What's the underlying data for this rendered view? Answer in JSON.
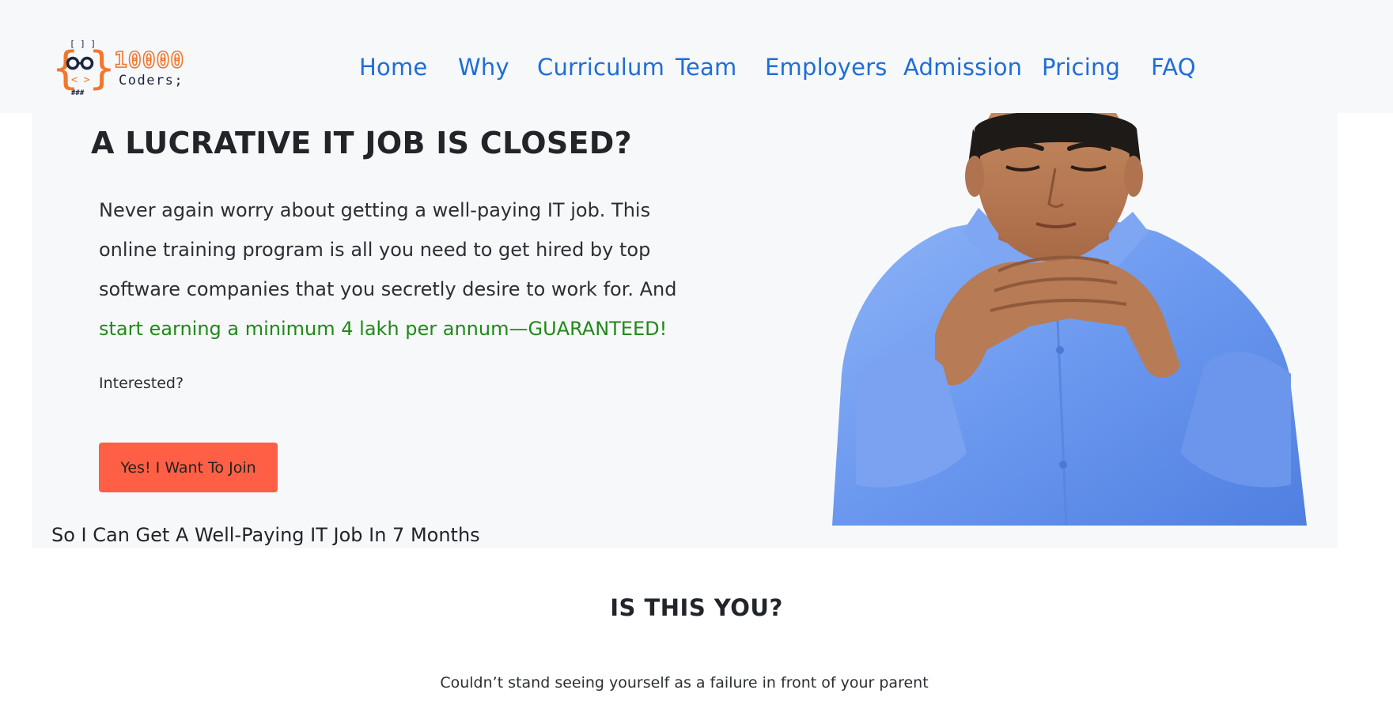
{
  "brand": {
    "logo_number": "10000",
    "logo_word": "Coders;",
    "logo_glyph_top": "[ ] ]",
    "logo_glyph_bottom": "###",
    "colors": {
      "orange": "#f0782d",
      "navy": "#1b2440"
    }
  },
  "nav": {
    "color": "#1e6ed8",
    "items": [
      {
        "label": "Home"
      },
      {
        "label": "Why"
      },
      {
        "label": "Curriculum"
      },
      {
        "label": "Team"
      },
      {
        "label": "Employers"
      },
      {
        "label": "Admission"
      },
      {
        "label": "Pricing"
      },
      {
        "label": "FAQ"
      }
    ]
  },
  "hero": {
    "title": "A LUCRATIVE IT JOB IS CLOSED?",
    "body_plain": "Never again worry about getting a well-paying IT job. This online training program is all you need to get hired by top software companies that you secretly desire to work for. And ",
    "body_highlight": "start earning a minimum 4 lakh per annum—GUARANTEED!",
    "interested": "Interested?",
    "cta_label": "Yes! I Want To Join",
    "subtext": "So I Can Get A Well-Paying IT Job In 7 Months",
    "colors": {
      "highlight": "#1f8a17",
      "cta": "#ff5f45"
    },
    "photo": "thoughtful-man-in-blue-shirt"
  },
  "section": {
    "title": "IS THIS YOU?",
    "line1": "Couldn’t stand seeing yourself as a failure in front of your parent"
  }
}
